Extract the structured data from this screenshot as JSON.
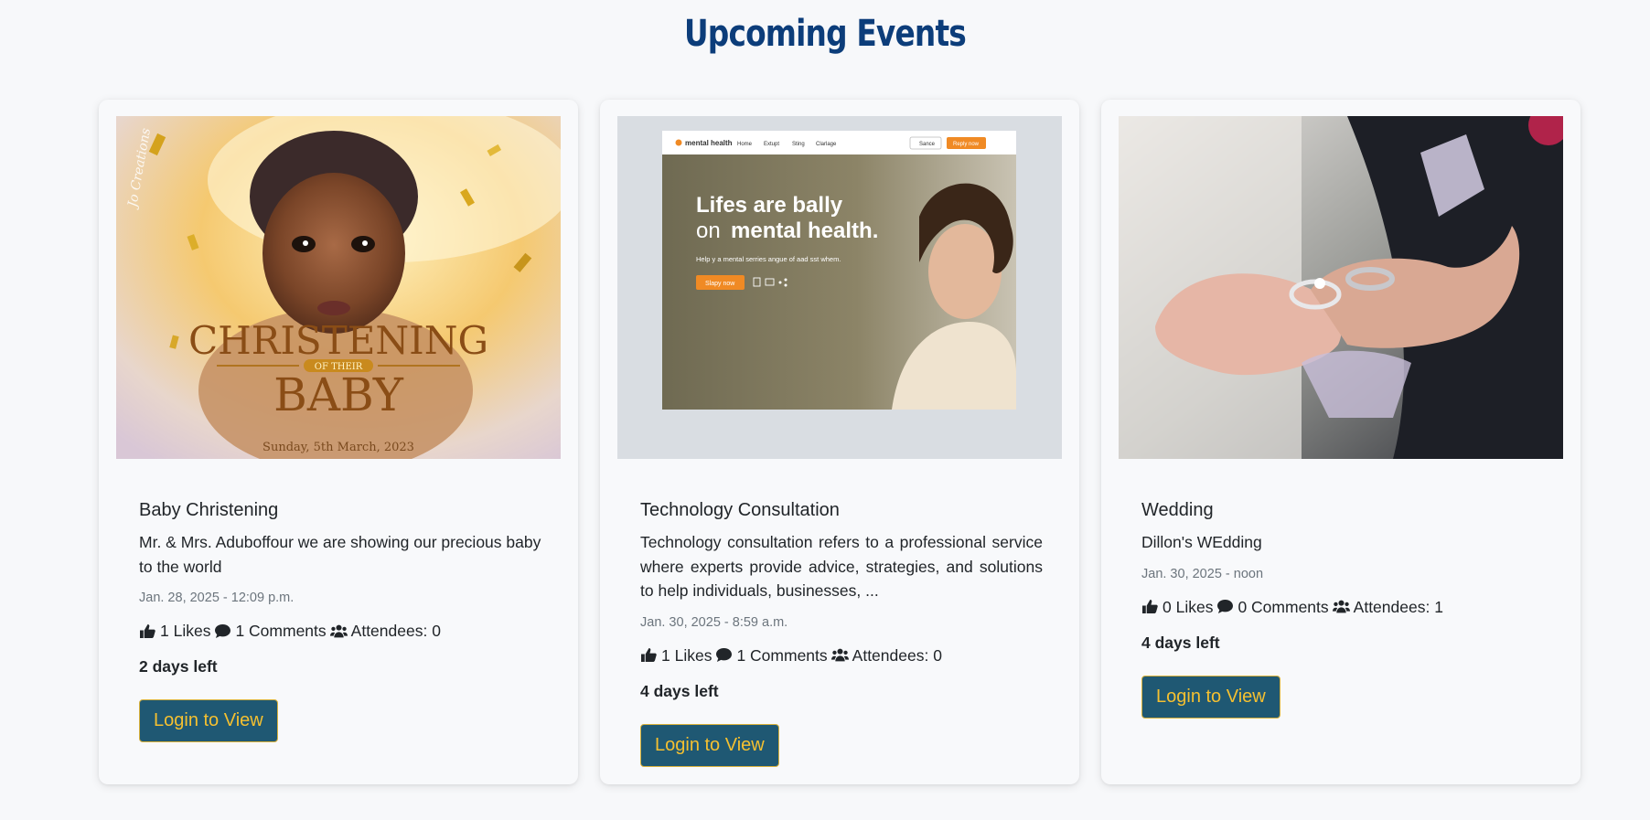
{
  "page": {
    "title": "Upcoming Events"
  },
  "events": [
    {
      "title": "Baby Christening",
      "description": "Mr. & Mrs. Aduboffour we are showing our precious baby to the world",
      "date": "Jan. 28, 2025 - 12:09 p.m.",
      "likes": "1 Likes",
      "comments": "1 Comments",
      "attendees": "Attendees: 0",
      "days_left": "2 days left",
      "button_label": "Login to View",
      "image": {
        "line1": "CHRISTENING",
        "ribbon": "OF THEIR",
        "line2": "BABY",
        "date": "Sunday, 5th March, 2023"
      }
    },
    {
      "title": "Technology Consultation",
      "description": "Technology consultation refers to a professional service where experts provide advice, strategies, and solutions to help individuals, businesses, ...",
      "date": "Jan. 30, 2025 - 8:59 a.m.",
      "likes": "1 Likes",
      "comments": "1 Comments",
      "attendees": "Attendees: 0",
      "days_left": "4 days left",
      "button_label": "Login to View",
      "image": {
        "brand": "mental health",
        "nav": [
          "Home",
          "Extupt",
          "Sting",
          "Clarlage"
        ],
        "nav_btn": "Sance",
        "cta_top": "Reply now",
        "headline1": "Lifes are bally",
        "headline2a": "on",
        "headline2b": "mental health.",
        "sub": "Help y a mental serries angue of aad sst whem.",
        "cta": "Slapy now"
      }
    },
    {
      "title": "Wedding",
      "description": "Dillon's WEdding",
      "date": "Jan. 30, 2025 - noon",
      "likes": "0 Likes",
      "comments": "0 Comments",
      "attendees": "Attendees: 1",
      "days_left": "4 days left",
      "button_label": "Login to View"
    }
  ],
  "colors": {
    "title": "#0c3d7a",
    "button_bg": "#1f5873",
    "button_text": "#f5c030",
    "card_bg": "#f8f9fb",
    "page_bg": "#f7f8fa"
  },
  "icons": {
    "likes": "thumbs-up-icon",
    "comments": "comment-icon",
    "attendees": "users-icon"
  }
}
